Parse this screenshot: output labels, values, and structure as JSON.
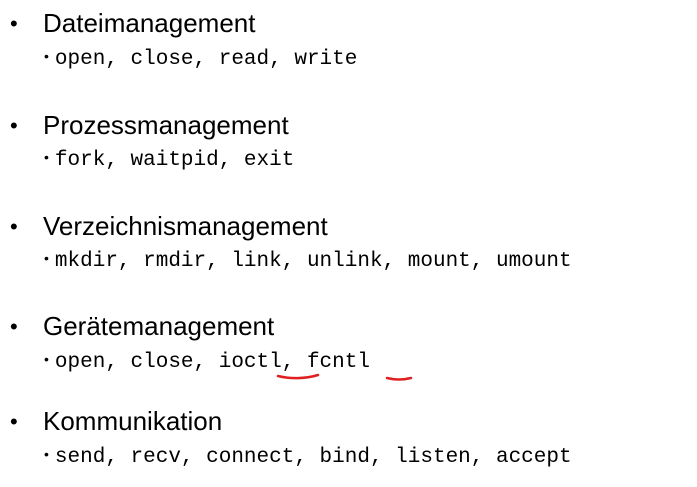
{
  "sections": [
    {
      "heading": "Dateimanagement",
      "calls": "open, close, read, write"
    },
    {
      "heading": "Prozessmanagement",
      "calls": "fork, waitpid, exit"
    },
    {
      "heading": "Verzeichnismanagement",
      "calls": "mkdir, rmdir, link, unlink, mount, umount"
    },
    {
      "heading": "Gerätemanagement",
      "calls": "open, close, ioctl, fcntl"
    },
    {
      "heading": "Kommunikation",
      "calls": "send, recv, connect, bind, listen, accept"
    }
  ],
  "bullet_glyph": "•",
  "subbullet_glyph": "•",
  "annotation_color": "#e02020"
}
